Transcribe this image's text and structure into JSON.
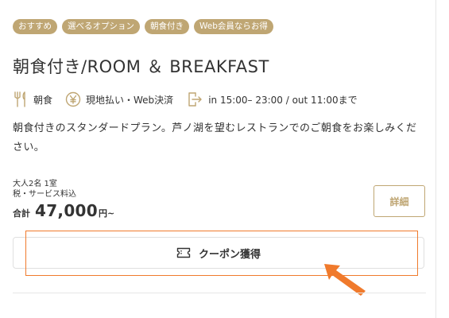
{
  "tags": [
    "おすすめ",
    "選べるオプション",
    "朝食付き",
    "Web会員ならお得"
  ],
  "plan": {
    "title": "朝食付き/ROOM ＆ BREAKFAST",
    "description": "朝食付きのスタンダードプラン。芦ノ湖を望むレストランでのご朝食をお楽しみください。"
  },
  "info": {
    "meal": {
      "icon": "fork-knife-icon",
      "label": "朝食"
    },
    "payment": {
      "icon": "yen-coin-icon",
      "label": "現地払い・Web決済"
    },
    "checkin": {
      "icon": "door-enter-icon",
      "label": "in 15:00– 23:00 / out 11:00まで"
    }
  },
  "price": {
    "occupancy": "大人2名 1室",
    "tax_note": "税・サービス料込",
    "prefix": "合計",
    "amount": "47,000",
    "suffix": "円~"
  },
  "buttons": {
    "details_label": "詳細",
    "coupon_label": "クーポン獲得",
    "coupon_icon": "ticket-icon"
  },
  "colors": {
    "accent_gold": "#bfa673",
    "highlight_orange": "#f07a2c",
    "text": "#333333"
  }
}
